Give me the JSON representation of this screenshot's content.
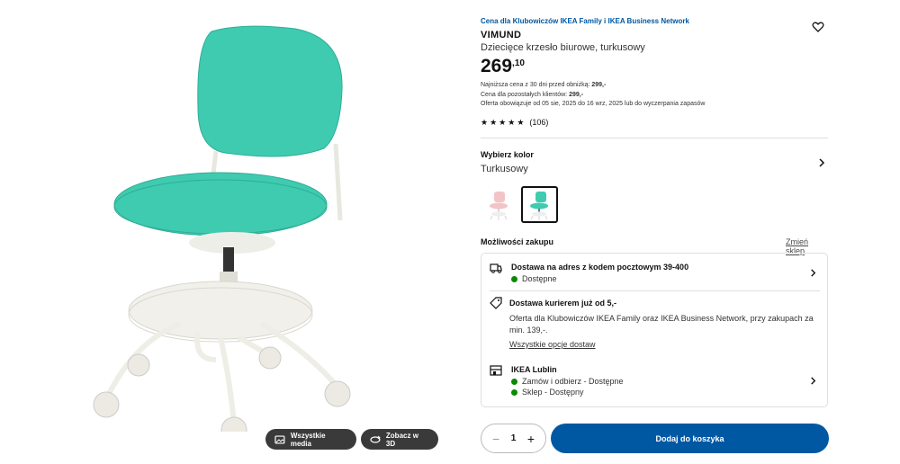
{
  "media": {
    "all_media_label": "Wszystkie media",
    "view_3d_label": "Zobacz w 3D"
  },
  "product": {
    "promo_label": "Cena dla Klubowiczów IKEA Family i IKEA Business Network",
    "name": "VIMUND",
    "description": "Dziecięce krzesło biurowe, turkusowy",
    "price_int": "269",
    "price_dec": ",10",
    "legal": {
      "line1_prefix": "Najniższa cena z 30 dni przed obniżką:",
      "line1_value": "299,-",
      "line2_prefix": "Cena dla pozostałych klientów:",
      "line2_value": "299,-",
      "line3": "Oferta obowiązuje od 05 sie, 2025 do 16 wrz, 2025 lub do wyczerpania zapasów"
    },
    "rating_value": 4.5,
    "rating_count": "(106)"
  },
  "color": {
    "title": "Wybierz kolor",
    "selected": "Turkusowy",
    "swatches": [
      "pink",
      "turquoise"
    ]
  },
  "purchase": {
    "title": "Możliwości zakupu",
    "change_store": "Zmień sklep",
    "delivery": {
      "title": "Dostawa na adres z kodem pocztowym 39-400",
      "status": "Dostępne"
    },
    "courier": {
      "title": "Dostawa kurierem już od 5,-",
      "offer": "Oferta dla Klubowiczów IKEA Family oraz IKEA Business Network, przy zakupach za min. 139,-.",
      "link": "Wszystkie opcje dostaw"
    },
    "store": {
      "title": "IKEA Lublin",
      "pickup": "Zamów i odbierz - Dostępne",
      "instore": "Sklep - Dostępny"
    }
  },
  "cart": {
    "quantity": "1",
    "minus": "−",
    "plus": "+",
    "add_label": "Dodaj do koszyka"
  },
  "colors": {
    "accent": "#0058a3",
    "available": "#0a8a00",
    "chair_turquoise": "#3fcbb0"
  }
}
